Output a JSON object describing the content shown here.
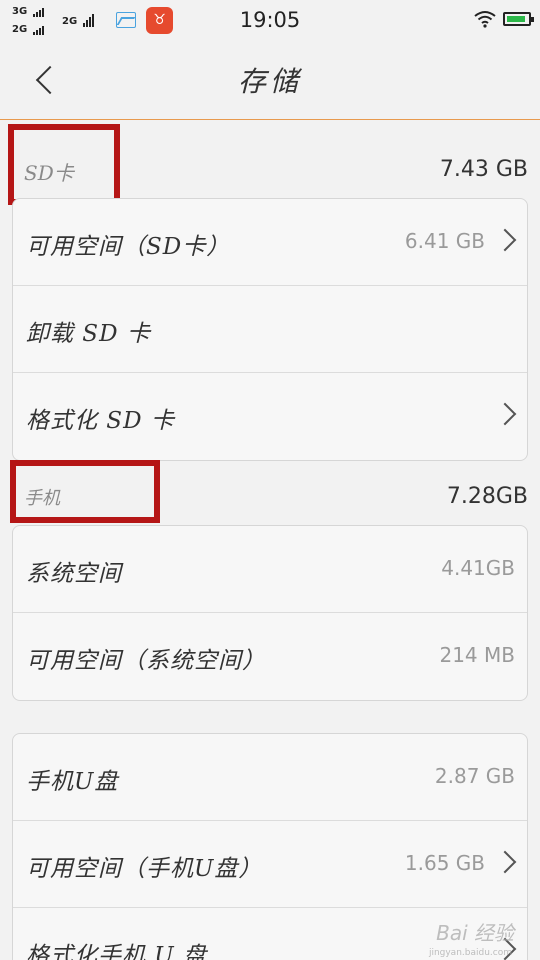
{
  "status_bar": {
    "sim1_network": "3G",
    "sim2_network": "2G",
    "extra_network": "2G",
    "time": "19:05",
    "icons": [
      "signal-icon",
      "picture-icon",
      "app-icon",
      "wifi-icon",
      "battery-icon"
    ],
    "battery_color": "#2db84a"
  },
  "header": {
    "title": "存储",
    "back_icon": "chevron-left-icon"
  },
  "sd_section": {
    "label": "SD卡",
    "total": "7.43 GB",
    "items": [
      {
        "label": "可用空间（SD卡）",
        "value": "6.41 GB"
      },
      {
        "label": "卸载 SD 卡"
      },
      {
        "label": "格式化 SD 卡"
      }
    ]
  },
  "phone_section": {
    "label": "手机",
    "total": "7.28GB",
    "items": [
      {
        "label": "系统空间",
        "value": "4.41GB"
      },
      {
        "label": "可用空间（系统空间）",
        "value": "214 MB"
      }
    ]
  },
  "usb_section": {
    "items": [
      {
        "label": "手机U盘",
        "value": "2.87 GB"
      },
      {
        "label": "可用空间（手机U盘）",
        "value": "1.65 GB"
      },
      {
        "label": "格式化手机 U 盘"
      }
    ]
  },
  "watermark": {
    "text": "Bai 经验",
    "sub": "jingyan.baidu.com"
  },
  "colors": {
    "highlight_box": "#b51616",
    "title_divider": "#e89a4e"
  }
}
